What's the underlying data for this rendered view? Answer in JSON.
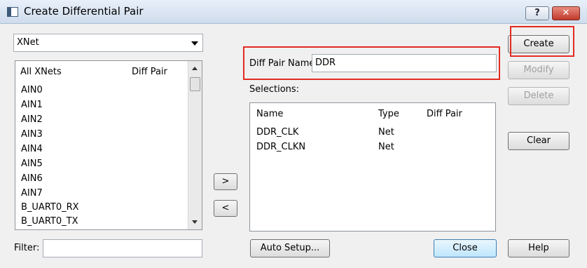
{
  "window": {
    "title": "Create Differential Pair",
    "help_label": "?",
    "close_label": "✕"
  },
  "left": {
    "net_type": "XNet",
    "columns": [
      "All XNets",
      "Diff Pair"
    ],
    "nets": [
      "AIN0",
      "AIN1",
      "AIN2",
      "AIN3",
      "AIN4",
      "AIN5",
      "AIN6",
      "AIN7",
      "B_UART0_RX",
      "B_UART0_TX"
    ],
    "filter_label": "Filter:",
    "filter_value": ""
  },
  "middle": {
    "add_label": ">",
    "remove_label": "<"
  },
  "right": {
    "diff_pair_name_label": "Diff Pair Name:",
    "diff_pair_name_value": "DDR",
    "selections_label": "Selections:",
    "columns": [
      "Name",
      "Type",
      "Diff Pair"
    ],
    "rows": [
      {
        "name": "DDR_CLK",
        "type": "Net",
        "diff_pair": ""
      },
      {
        "name": "DDR_CLKN",
        "type": "Net",
        "diff_pair": ""
      }
    ],
    "auto_setup_label": "Auto Setup...",
    "close_label": "Close"
  },
  "buttons": {
    "create": "Create",
    "modify": "Modify",
    "delete": "Delete",
    "clear": "Clear",
    "help": "Help"
  },
  "colors": {
    "highlight": "#e32b22",
    "dialog_bg": "#f0f0f0"
  }
}
